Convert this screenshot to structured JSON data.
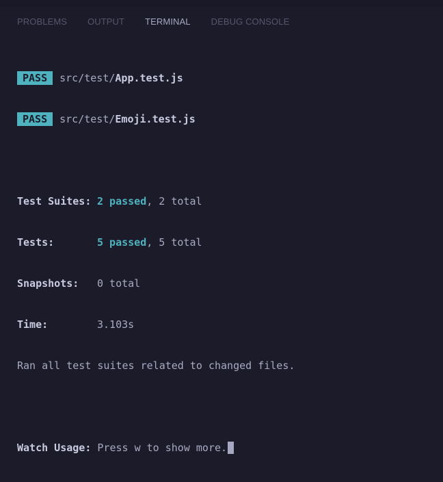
{
  "tabs": [
    {
      "label": "PROBLEMS",
      "active": false
    },
    {
      "label": "OUTPUT",
      "active": false
    },
    {
      "label": "TERMINAL",
      "active": true
    },
    {
      "label": "DEBUG CONSOLE",
      "active": false
    }
  ],
  "results": [
    {
      "badge": "PASS",
      "path": "src/test/",
      "file": "App.test.js"
    },
    {
      "badge": "PASS",
      "path": "src/test/",
      "file": "Emoji.test.js"
    }
  ],
  "summary": {
    "suites_label": "Test Suites:",
    "suites_passed": "2 passed",
    "suites_total": ", 2 total",
    "tests_label": "Tests:",
    "tests_passed": "5 passed",
    "tests_total": ", 5 total",
    "snapshots_label": "Snapshots:",
    "snapshots_value": "0 total",
    "time_label": "Time:",
    "time_value": "3.103s",
    "ran_message": "Ran all test suites related to changed files."
  },
  "watch": {
    "label": "Watch Usage:",
    "message": "Press w to show more."
  },
  "colors": {
    "background": "#1c1b2a",
    "accent": "#4fb3bf",
    "text": "#a8aac2"
  }
}
